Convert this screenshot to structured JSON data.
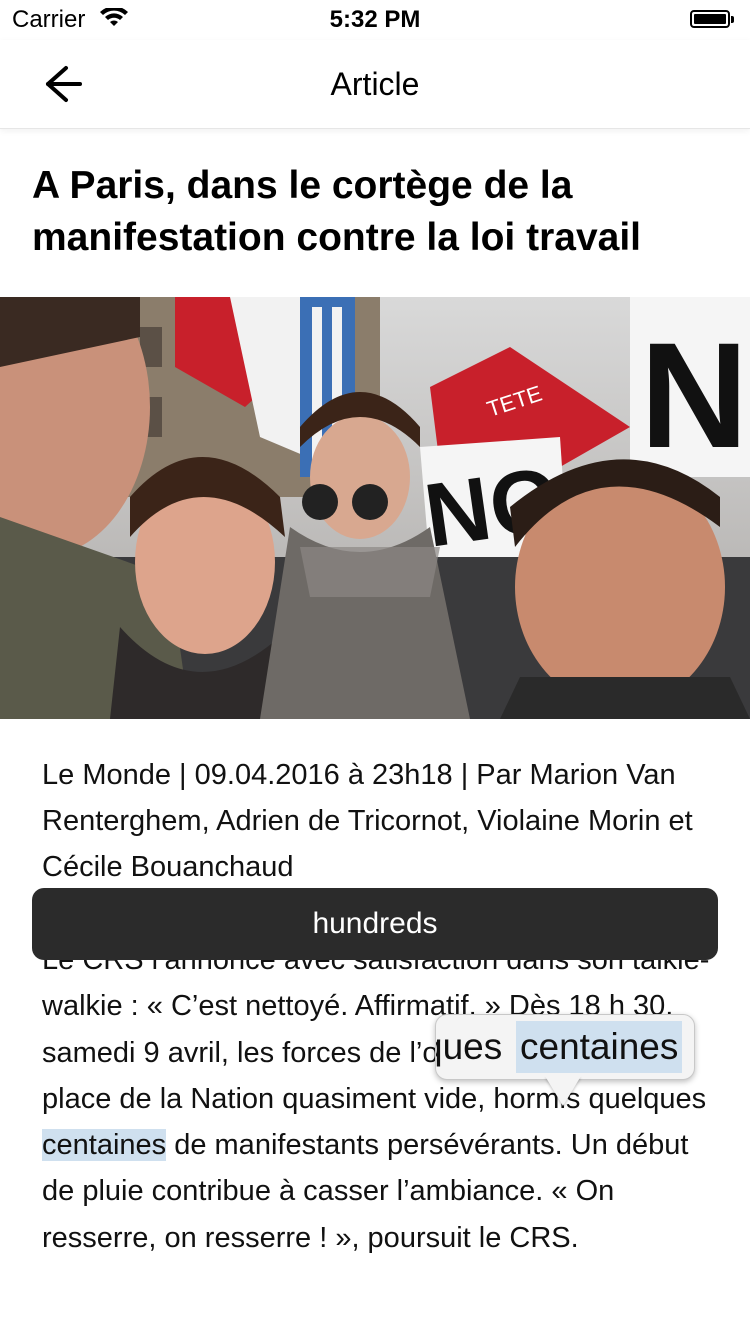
{
  "status_bar": {
    "carrier": "Carrier",
    "time": "5:32 PM",
    "icons": [
      "wifi-icon",
      "battery-icon"
    ]
  },
  "nav": {
    "title": "Article",
    "back_icon": "arrow-left-icon"
  },
  "article": {
    "headline": "A Paris, dans le cortège de la manifestation contre la loi travail",
    "photo_description_icon": "protest-photo",
    "byline": "Le Monde | 09.04.2016 à 23h18 | Par Marion Van Renterghem, Adrien de Tricornot, Violaine Morin et Cécile Bouanchaud",
    "para_before": "Le CRS l’annonce avec satisfaction dans son talkie-walkie : « C’est nettoyé. Affirmatif. » Dès 18 h 30, samedi 9 avril, les forces de l’ordre encadrent une place de la Nation quasiment vide, hormis quelques ",
    "para_highlight": "centaines",
    "para_after": " de manifestants persévérants. Un début de pluie contribue à casser l’ambiance. « On resserre, on resserre ! », poursuit le CRS."
  },
  "translation_banner": {
    "text": "hundreds"
  },
  "magnifier": {
    "left_text": "ques",
    "selected_text": "centaines"
  },
  "colors": {
    "selection": "#cfe0ef",
    "banner_bg": "#2b2b2b"
  }
}
